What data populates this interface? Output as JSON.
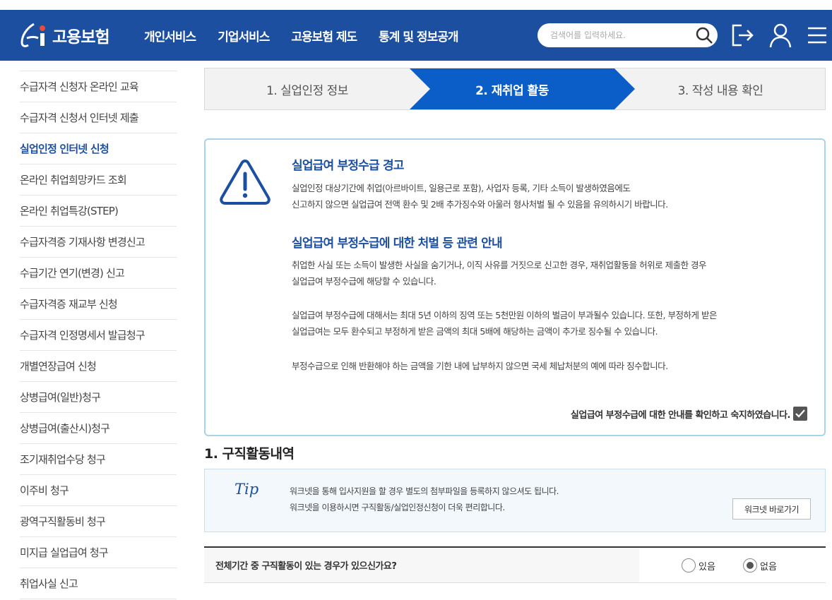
{
  "header": {
    "logo_text": "고용보험",
    "nav": [
      "개인서비스",
      "기업서비스",
      "고용보험 제도",
      "통계 및 정보공개"
    ],
    "search_placeholder": "검색어를 입력하세요."
  },
  "sidebar": {
    "items": [
      "수급자격 신청자 온라인 교육",
      "수급자격 신청서 인터넷 제출",
      "실업인정 인터넷 신청",
      "온라인 취업희망카드 조회",
      "온라인 취업특강(STEP)",
      "수급자격증 기재사항 변경신고",
      "수급기간 연기(변경) 신고",
      "수급자격증 재교부 신청",
      "수급자격 인정명세서 발급청구",
      "개별연장급여 신청",
      "상병급여(일반)청구",
      "상병급여(출산시)청구",
      "조기재취업수당 청구",
      "이주비 청구",
      "광역구직활동비 청구",
      "미지급 실업급여 청구",
      "취업사실 신고"
    ],
    "active": "실업인정 인터넷 신청"
  },
  "steps": [
    "1. 실업인정 정보",
    "2. 재취업 활동",
    "3. 작성 내용 확인"
  ],
  "warning": {
    "title1": "실업급여 부정수급 경고",
    "text1_line1": "실업인정 대상기간에 취업(아르바이트, 일용근로 포함), 사업자 등록, 기타 소득이 발생하였음에도",
    "text1_line2": "신고하지 않으면 실업급여 전액 환수 및 2배 추가징수와 아울러 형사처벌 될 수 있음을 유의하시기 바랍니다.",
    "title2": "실업급여 부정수급에 대한 처벌 등 관련 안내",
    "text2_line1": "취업한 사실 또는 소득이 발생한 사실을 숨기거나, 이직 사유를 거짓으로 신고한 경우, 재취업활동을 허위로 제출한 경우",
    "text2_line2": "실업급여 부정수급에 해당할 수 있습니다.",
    "text3_line1": "실업급여 부정수급에 대해서는 최대 5년 이하의 징역 또는 5천만원 이하의 벌금이 부과될수 있습니다. 또한, 부정하게 받은",
    "text3_line2": "실업급여는 모두 환수되고 부정하게 받은 금액의 최대 5배에 해당하는 금액이 추가로 징수될 수 있습니다.",
    "text4": "부정수급으로 인해 반환해야 하는 금액을 기한 내에 납부하지 않으면 국세 체납처분의 예에 따라 징수합니다.",
    "confirm_label": "실업급여 부정수급에 대한 안내를 확인하고 숙지하였습니다."
  },
  "section": {
    "title": "1. 구직활동내역",
    "tip_label": "Tip",
    "tip_line1": "워크넷을 통해 입사지원을 할 경우 별도의 첨부파일을 등록하지 않으셔도 됩니다.",
    "tip_line2": "워크넷을 이용하시면 구직활동/실업인정신청이 더욱 편리합니다.",
    "worknet_button": "워크넷 바로가기",
    "question": "전체기간 중 구직활동이 있는 경우가 있으신가요?",
    "option_yes": "있음",
    "option_no": "없음",
    "selected": "없음"
  },
  "colors": {
    "brand": "#1d4fa0",
    "step_active": "#0b5ec7",
    "warn_border": "#a9d3ea"
  }
}
